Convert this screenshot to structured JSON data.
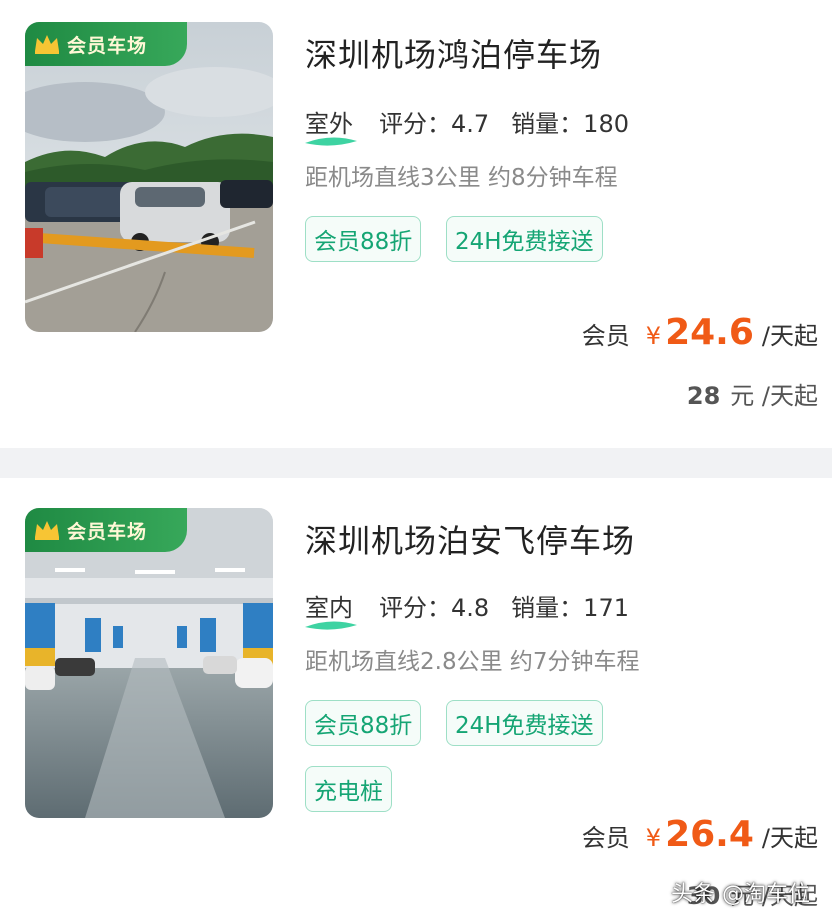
{
  "colors": {
    "accent": "#f05a16",
    "tag_green": "#15a574",
    "badge_green": "#2b9a4f"
  },
  "listings": [
    {
      "badge": "会员车场",
      "title": "深圳机场鸿泊停车场",
      "type": "室外",
      "rating_label": "评分：",
      "rating": "4.7",
      "sales_label": "销量：",
      "sales": "180",
      "distance": "距机场直线3公里 约8分钟车程",
      "tags": [
        "会员88折",
        "24H免费接送"
      ],
      "member_label": "会员",
      "currency": "¥",
      "member_price": "24.6",
      "price_unit": "/天起",
      "original_price": "28",
      "original_unit": "元 /天起",
      "image_icon": "outdoor-parking-lot-photo"
    },
    {
      "badge": "会员车场",
      "title": "深圳机场泊安飞停车场",
      "type": "室内",
      "rating_label": "评分：",
      "rating": "4.8",
      "sales_label": "销量：",
      "sales": "171",
      "distance": "距机场直线2.8公里 约7分钟车程",
      "tags": [
        "会员88折",
        "24H免费接送",
        "充电桩"
      ],
      "member_label": "会员",
      "currency": "¥",
      "member_price": "26.4",
      "price_unit": "/天起",
      "original_price": "30",
      "original_unit": "元 /天起",
      "image_icon": "indoor-parking-garage-photo"
    }
  ],
  "watermark": "头条 @淘车位"
}
